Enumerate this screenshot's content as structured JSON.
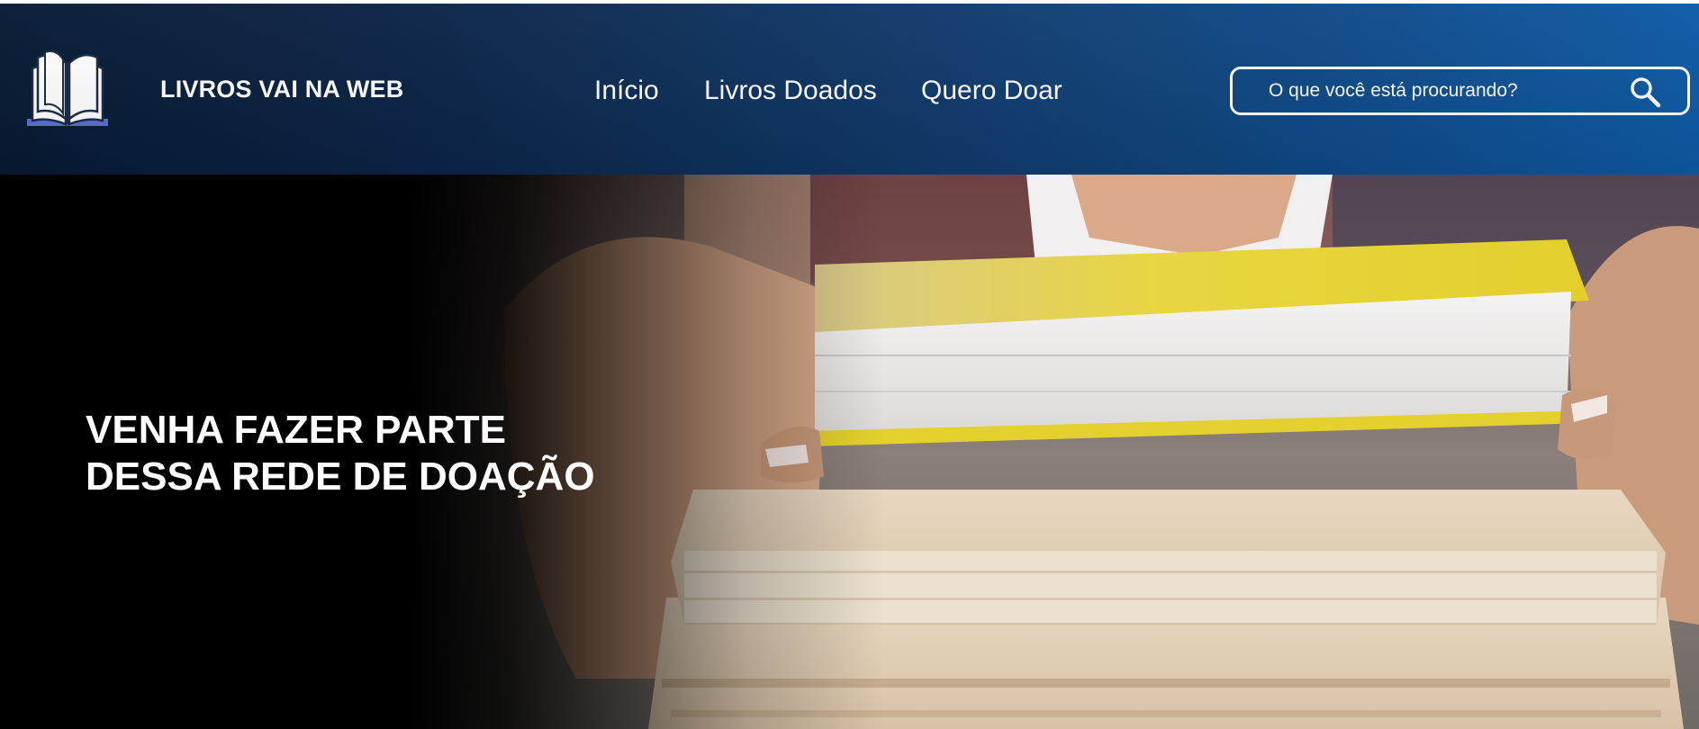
{
  "header": {
    "brand": "LIVROS VAI NA WEB",
    "logo_icon": "open-book-icon",
    "nav": [
      {
        "label": "Início"
      },
      {
        "label": "Livros Doados"
      },
      {
        "label": "Quero Doar"
      }
    ],
    "search": {
      "placeholder": "O que você está procurando?",
      "icon": "search-icon"
    },
    "colors": {
      "gradient_start": "#071a33",
      "gradient_end": "#0d5aa6",
      "text": "#ffffff"
    }
  },
  "hero": {
    "title_lines": [
      "VENHA FAZER PARTE",
      "DESSA REDE DE DOAÇÃO"
    ],
    "image": "hands-holding-stack-of-books-photo",
    "colors": {
      "fade": "#000000",
      "book_cover": "#e7d43a"
    }
  }
}
